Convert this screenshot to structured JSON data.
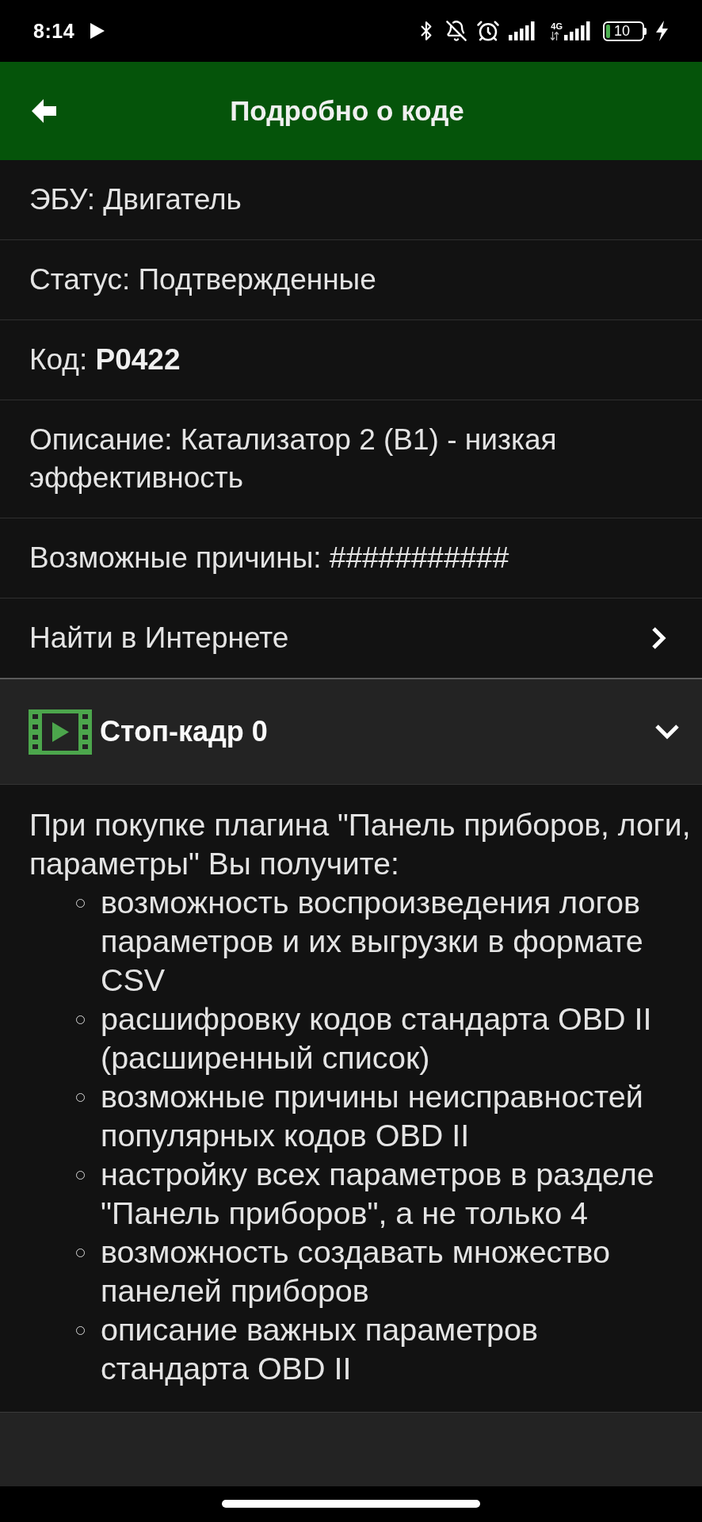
{
  "status_bar": {
    "time": "8:14",
    "network_type": "4G",
    "battery": "10"
  },
  "app_bar": {
    "title": "Подробно о коде"
  },
  "details": [
    {
      "kind": "text",
      "text": "ЭБУ: Двигатель"
    },
    {
      "kind": "text",
      "text": "Статус: Подтвержденные"
    },
    {
      "kind": "text",
      "text": "Код: **P0422**"
    },
    {
      "kind": "text",
      "text": "Описание: Катализатор 2 (B1) - низкая эффективность"
    },
    {
      "kind": "text",
      "text": "Возможные причины: ###########"
    },
    {
      "kind": "link",
      "text": "Найти в Интернете"
    }
  ],
  "freeze_frame": {
    "title": "Стоп-кадр 0"
  },
  "plugin_info": {
    "intro": "При покупке плагина \"Панель приборов, логи, параметры\" Вы получите:",
    "items": [
      "возможность воспроизведения логов параметров и их выгрузки в формате CSV",
      "расшифровку кодов стандарта OBD II (расширенный список)",
      "возможные причины неисправностей популярных кодов OBD II",
      "настройку всех параметров в разделе \"Панель приборов\", а не только 4",
      "возможность создавать множество панелей приборов",
      "описание важных параметров стандарта OBD II"
    ]
  }
}
